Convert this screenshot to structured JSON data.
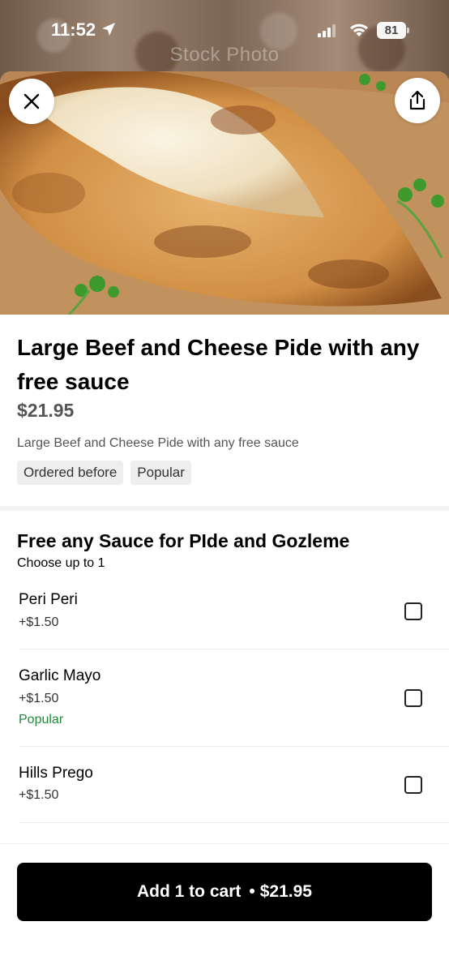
{
  "background": {
    "watermark": "Stock Photo"
  },
  "status_bar": {
    "time": "11:52",
    "battery": "81"
  },
  "header": {
    "close_icon": "close-icon",
    "share_icon": "share-icon"
  },
  "item": {
    "title": "Large Beef and Cheese Pide with any free sauce",
    "price": "$21.95",
    "description": "Large Beef and Cheese Pide with any free sauce",
    "tags": [
      "Ordered before",
      "Popular"
    ]
  },
  "options_group": {
    "title": "Free any Sauce for PIde and Gozleme",
    "subtitle": "Choose up to 1",
    "options": [
      {
        "name": "Peri Peri",
        "price": "+$1.50",
        "badge": ""
      },
      {
        "name": "Garlic Mayo",
        "price": "+$1.50",
        "badge": "Popular"
      },
      {
        "name": "Hills Prego",
        "price": "+$1.50",
        "badge": ""
      }
    ]
  },
  "cart": {
    "label": "Add 1 to cart",
    "total": "$21.95"
  },
  "colors": {
    "accent": "#000000",
    "popular": "#1e8a3c",
    "price_grey": "#545454"
  }
}
